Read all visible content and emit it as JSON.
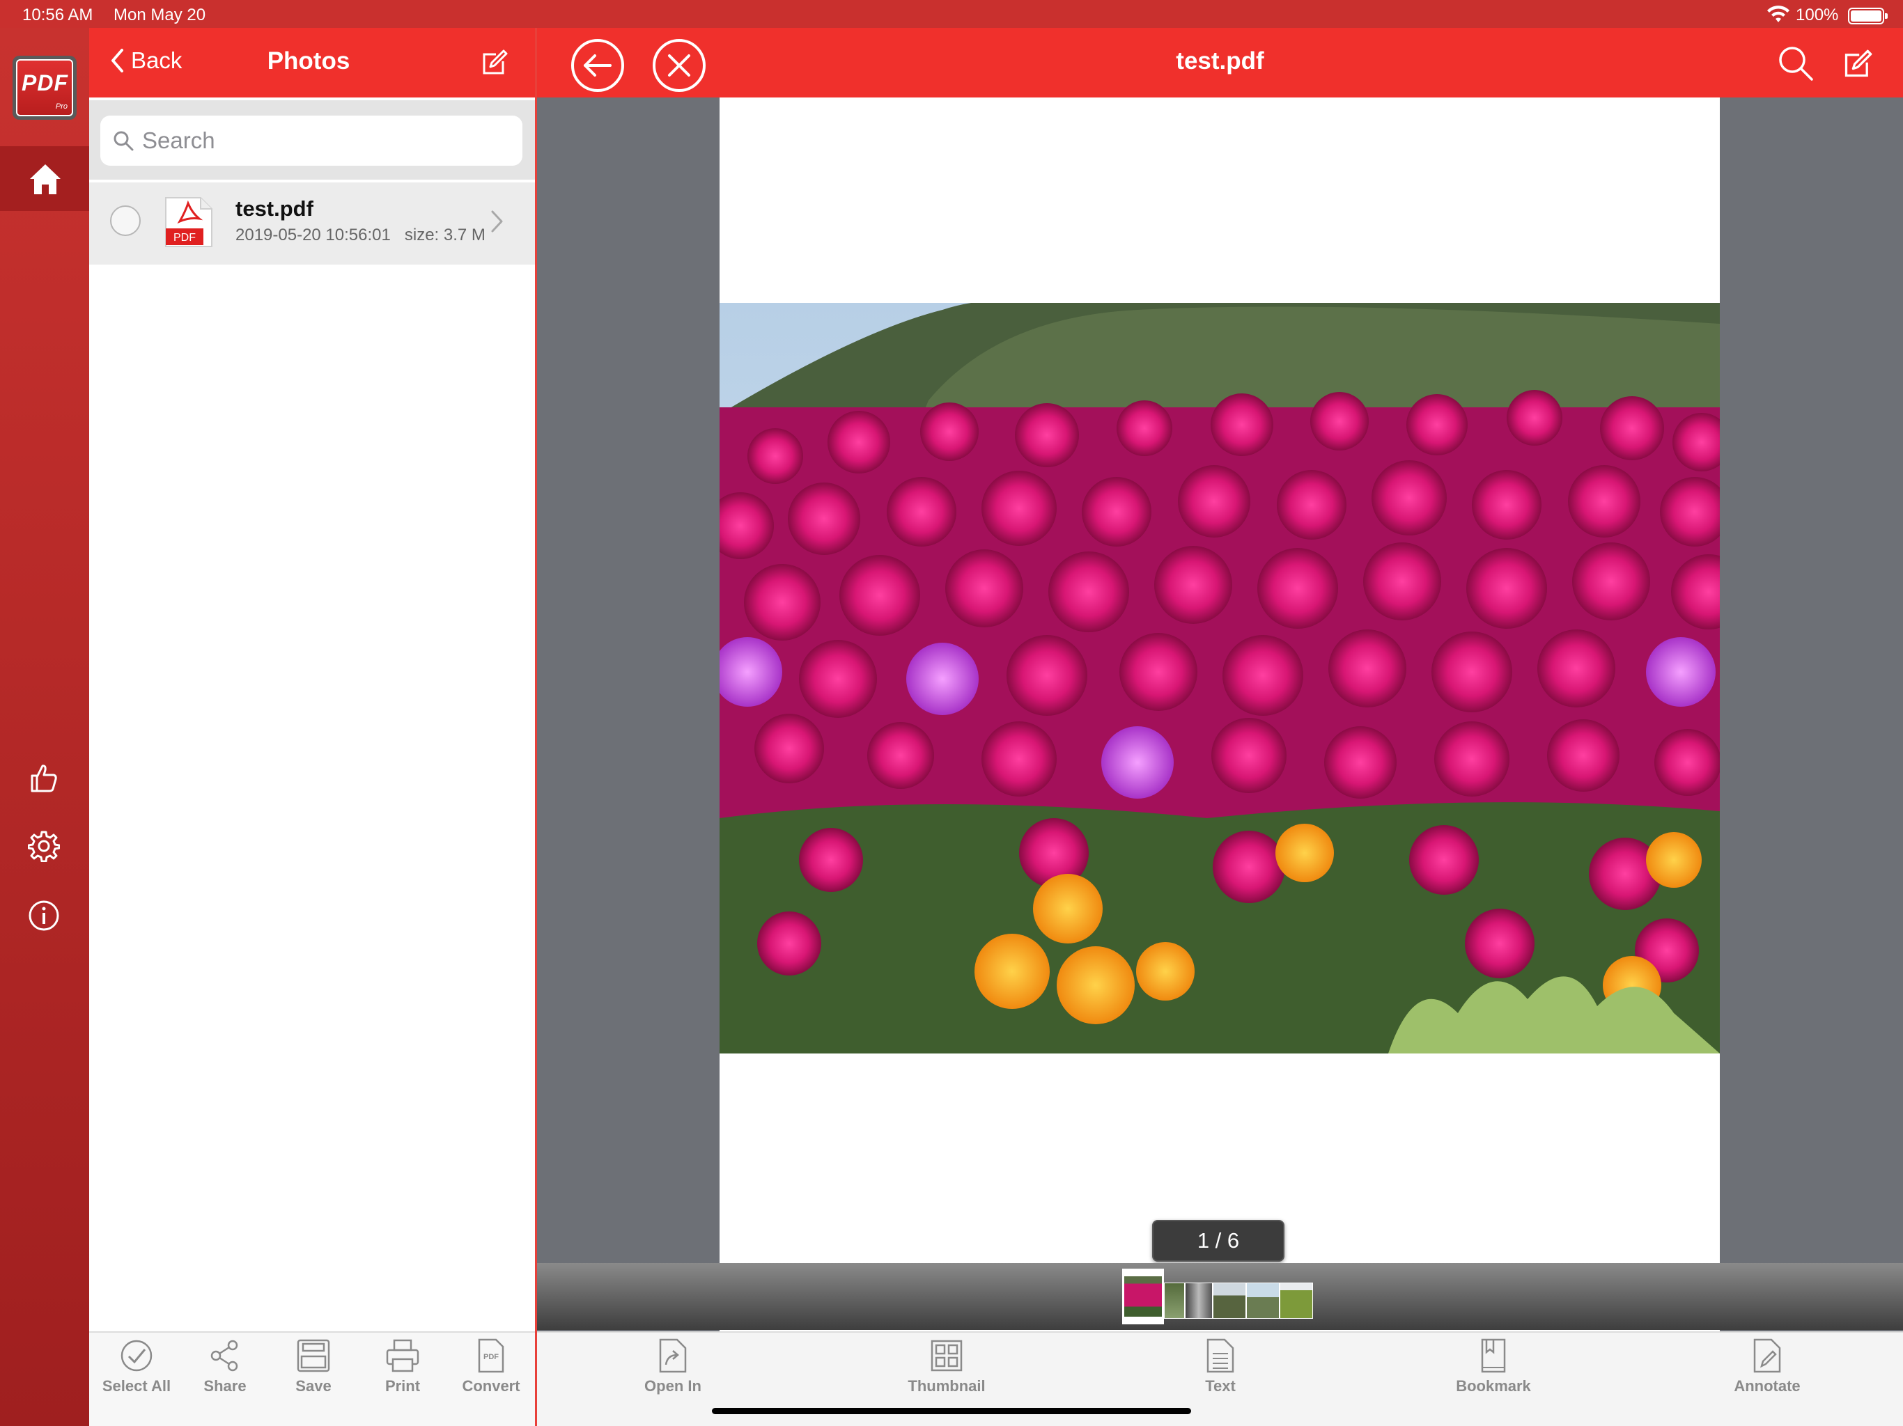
{
  "status": {
    "time": "10:56 AM",
    "date": "Mon May 20",
    "battery": "100%"
  },
  "rail": {
    "logo_text": "PDF",
    "logo_sub": "Pro"
  },
  "left": {
    "back_label": "Back",
    "title": "Photos",
    "search_placeholder": "Search",
    "files": [
      {
        "name": "test.pdf",
        "meta": "2019-05-20 10:56:01   size: 3.7 M",
        "icon_label": "PDF"
      }
    ],
    "toolbar": [
      {
        "label": "Select All",
        "icon": "checkmark-circle-icon"
      },
      {
        "label": "Share",
        "icon": "share-icon"
      },
      {
        "label": "Save",
        "icon": "save-icon"
      },
      {
        "label": "Print",
        "icon": "print-icon"
      },
      {
        "label": "Convert",
        "icon": "convert-pdf-icon"
      }
    ]
  },
  "viewer": {
    "title": "test.pdf",
    "page_indicator": "1 / 6",
    "toolbar": [
      {
        "label": "Open In",
        "icon": "open-in-icon"
      },
      {
        "label": "Thumbnail",
        "icon": "thumbnail-grid-icon"
      },
      {
        "label": "Text",
        "icon": "text-document-icon"
      },
      {
        "label": "Bookmark",
        "icon": "bookmark-icon"
      },
      {
        "label": "Annotate",
        "icon": "annotate-icon"
      }
    ]
  },
  "colors": {
    "accent": "#f0302c",
    "rail": "#b62727",
    "viewer_bg": "#6d7076"
  }
}
